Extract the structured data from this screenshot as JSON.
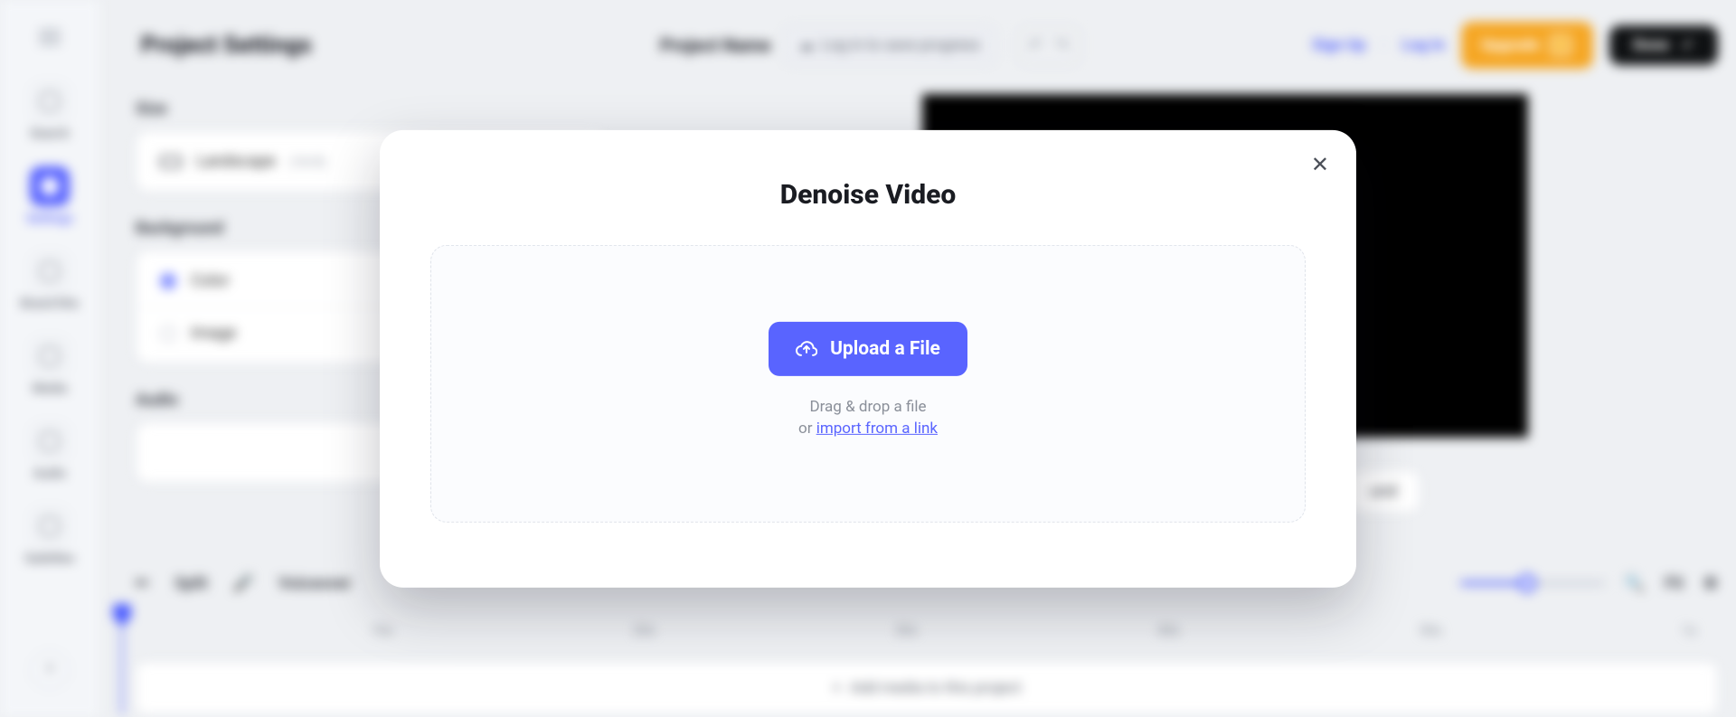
{
  "header": {
    "page_title": "Project Settings",
    "project_name_label": "Project Name",
    "save_progress": "Log in to save progress",
    "signup": "Sign Up",
    "login": "Log In",
    "upgrade": "Upgrade",
    "done": "Done"
  },
  "sidebar": {
    "items": [
      {
        "label": "Search"
      },
      {
        "label": "Settings"
      },
      {
        "label": "Brand Kits"
      },
      {
        "label": "Media"
      },
      {
        "label": "Audio"
      },
      {
        "label": "Subtitles"
      }
    ]
  },
  "settings": {
    "size_label": "Size",
    "orientation": "Landscape",
    "orientation_ratio": "(16:9)",
    "background_label": "Background",
    "bg_color": "Color",
    "bg_image": "Image",
    "audio_label": "Audio",
    "bg_chip": "und"
  },
  "timeline": {
    "split": "Split",
    "voiceover": "Voiceover",
    "fit": "Fit",
    "ticks": [
      "10s",
      "20s",
      "30s",
      "40s",
      "50s",
      "1s"
    ],
    "add_media": "Add media to this project"
  },
  "modal": {
    "title": "Denoise Video",
    "upload_button": "Upload a File",
    "dragdrop_line": "Drag & drop a file",
    "or_prefix": "or ",
    "import_link": "import from a link"
  }
}
